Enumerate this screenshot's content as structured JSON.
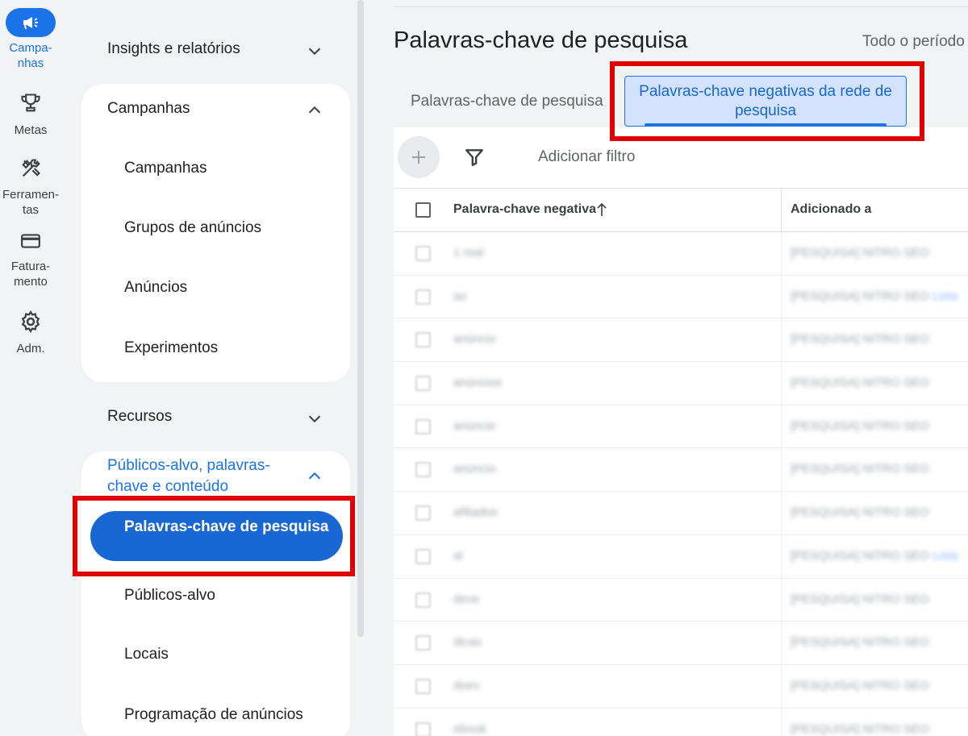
{
  "rail": [
    {
      "label": "Campa-\nnhas",
      "icon": "megaphone-icon",
      "active": true
    },
    {
      "label": "Metas",
      "icon": "trophy-icon"
    },
    {
      "label": "Ferramen-\ntas",
      "icon": "tools-icon"
    },
    {
      "label": "Fatura-\nmento",
      "icon": "credit-card-icon"
    },
    {
      "label": "Adm.",
      "icon": "gear-icon"
    }
  ],
  "nav": {
    "insights": "Insights e relatórios",
    "campanhas_header": "Campanhas",
    "campanhas_items": [
      "Campanhas",
      "Grupos de anúncios",
      "Anúncios",
      "Experimentos"
    ],
    "recursos": "Recursos",
    "publicos_header": "Públicos-alvo, palavras-chave e conteúdo",
    "selected_item": "Palavras-chave de pesquisa",
    "publicos_items": [
      "Públicos-alvo",
      "Locais",
      "Programação de anúncios"
    ]
  },
  "main": {
    "title": "Palavras-chave de pesquisa",
    "period": "Todo o período",
    "tab_search": "Palavras-chave de pesquisa",
    "tab_negative": "Palavras-chave negativas da rede de pesquisa",
    "add_filter": "Adicionar filtro",
    "col_keyword": "Palavra-chave negativa",
    "col_added": "Adicionado a"
  },
  "rows": [
    {
      "keyword": "1 real",
      "added": "[PESQUISA] NITRO SEO",
      "link": ""
    },
    {
      "keyword": "ao",
      "added": "[PESQUISA] NITRO SEO",
      "link": "Lista"
    },
    {
      "keyword": "anúncio",
      "added": "[PESQUISA] NITRO SEO",
      "link": ""
    },
    {
      "keyword": "anúncios",
      "added": "[PESQUISA] NITRO SEO",
      "link": ""
    },
    {
      "keyword": "anúncie",
      "added": "[PESQUISA] NITRO SEO",
      "link": ""
    },
    {
      "keyword": "anúncio",
      "added": "[PESQUISA] NITRO SEO",
      "link": ""
    },
    {
      "keyword": "afiliados",
      "added": "[PESQUISA] NITRO SEO",
      "link": ""
    },
    {
      "keyword": "al",
      "added": "[PESQUISA] NITRO SEO",
      "link": "Lista"
    },
    {
      "keyword": "deve",
      "added": "[PESQUISA] NITRO SEO",
      "link": ""
    },
    {
      "keyword": "dicas",
      "added": "[PESQUISA] NITRO SEO",
      "link": ""
    },
    {
      "keyword": "does",
      "added": "[PESQUISA] NITRO SEO",
      "link": ""
    },
    {
      "keyword": "ebook",
      "added": "[PESQUISA] NITRO SEO",
      "link": ""
    }
  ],
  "colors": {
    "accent": "#1a73e8",
    "highlight": "#e00000",
    "tab_bg": "#d3e3fd"
  }
}
